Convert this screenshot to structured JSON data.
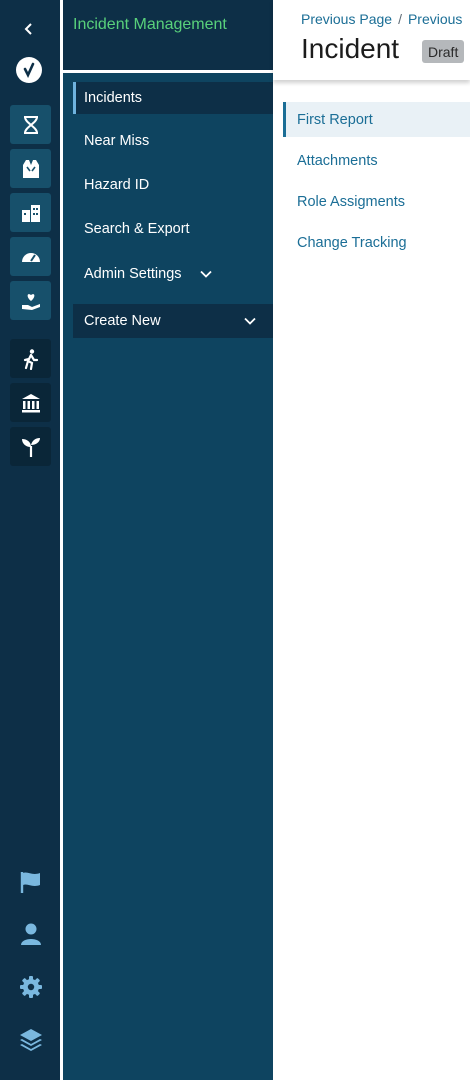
{
  "rail": {
    "top_icons": [
      "chevron-left-icon",
      "logo-check-icon"
    ],
    "group1_icons": [
      "dna-icon",
      "safety-vest-icon",
      "buildings-icon",
      "dashboard-gauge-icon",
      "hand-heart-icon"
    ],
    "group2_icons": [
      "walking-person-icon",
      "institution-icon",
      "sprout-icon"
    ],
    "bottom_icons": [
      "flag-icon",
      "user-icon",
      "gear-icon",
      "layers-icon"
    ]
  },
  "nav": {
    "title": "Incident Management",
    "items": [
      {
        "label": "Incidents"
      },
      {
        "label": "Near Miss"
      },
      {
        "label": "Hazard ID"
      },
      {
        "label": "Search & Export"
      },
      {
        "label": "Admin Settings"
      },
      {
        "label": "Create New"
      }
    ]
  },
  "main": {
    "breadcrumb": [
      "Previous Page",
      "/",
      "Previous"
    ],
    "title": "Incident",
    "status": "Draft",
    "tabs": [
      {
        "label": "First Report"
      },
      {
        "label": "Attachments"
      },
      {
        "label": "Role Assigments"
      },
      {
        "label": "Change Tracking"
      }
    ]
  },
  "colors": {
    "rail_bg": "#0d2f47",
    "nav_bg": "#0e4460",
    "accent_green": "#59d17b",
    "link_blue": "#1b6e96",
    "active_tab_bg": "#e9f1f6"
  }
}
